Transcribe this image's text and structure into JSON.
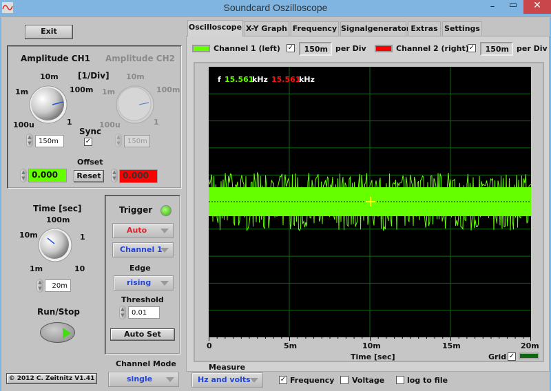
{
  "window": {
    "title": "Soundcard Oszilloscope",
    "minimize": "–",
    "maximize": "▭",
    "close": "✕"
  },
  "exit_label": "Exit",
  "amplitude": {
    "ch1_title": "Amplitude CH1",
    "ch2_title": "Amplitude CH2",
    "unit": "[1/Div]",
    "scale": [
      "100u",
      "1m",
      "10m",
      "100m",
      "1"
    ],
    "ch1_value": "150m",
    "ch2_value": "150m",
    "sync_label": "Sync",
    "sync_checked": true,
    "offset_label": "Offset",
    "offset_ch1": "0.000",
    "offset_ch2": "0.000",
    "reset_label": "Reset"
  },
  "time": {
    "title": "Time [sec]",
    "scale": [
      "1m",
      "10m",
      "100m",
      "1",
      "10"
    ],
    "value": "20m"
  },
  "run_stop_label": "Run/Stop",
  "trigger": {
    "title": "Trigger",
    "mode": "Auto",
    "channel": "Channel 1",
    "edge_label": "Edge",
    "edge": "rising",
    "threshold_label": "Threshold",
    "threshold": "0.01",
    "auto_set_label": "Auto Set",
    "led_color": "#44cc22"
  },
  "channel_mode": {
    "label": "Channel Mode",
    "value": "single"
  },
  "copyright": "© 2012  C. Zeitnitz V1.41",
  "tabs": [
    "Oscilloscope",
    "X-Y Graph",
    "Frequency",
    "Signalgenerator",
    "Extras",
    "Settings"
  ],
  "active_tab": "Oscilloscope",
  "channels": {
    "ch1_label": "Channel 1 (left)",
    "ch1_color": "#66ff00",
    "ch1_enabled": true,
    "ch1_per_div": "150m",
    "ch2_label": "Channel 2 (right)",
    "ch2_color": "#ff0000",
    "ch2_enabled": true,
    "ch2_per_div": "150m",
    "per_div_label": "per Div"
  },
  "scope": {
    "freq_prefix": "f",
    "freq_ch1": "15.561",
    "freq_ch2": "15.561",
    "freq_unit": "kHz",
    "x_ticks": [
      "0",
      "5m",
      "10m",
      "15m",
      "20m"
    ],
    "x_label": "Time [sec]",
    "grid_label": "Grid",
    "grid_checked": true,
    "grid_color": "#116611"
  },
  "measure": {
    "label": "Measure",
    "mode": "Hz and volts",
    "frequency_label": "Frequency",
    "frequency_checked": true,
    "voltage_label": "Voltage",
    "voltage_checked": false,
    "log_label": "log to file",
    "log_checked": false
  }
}
